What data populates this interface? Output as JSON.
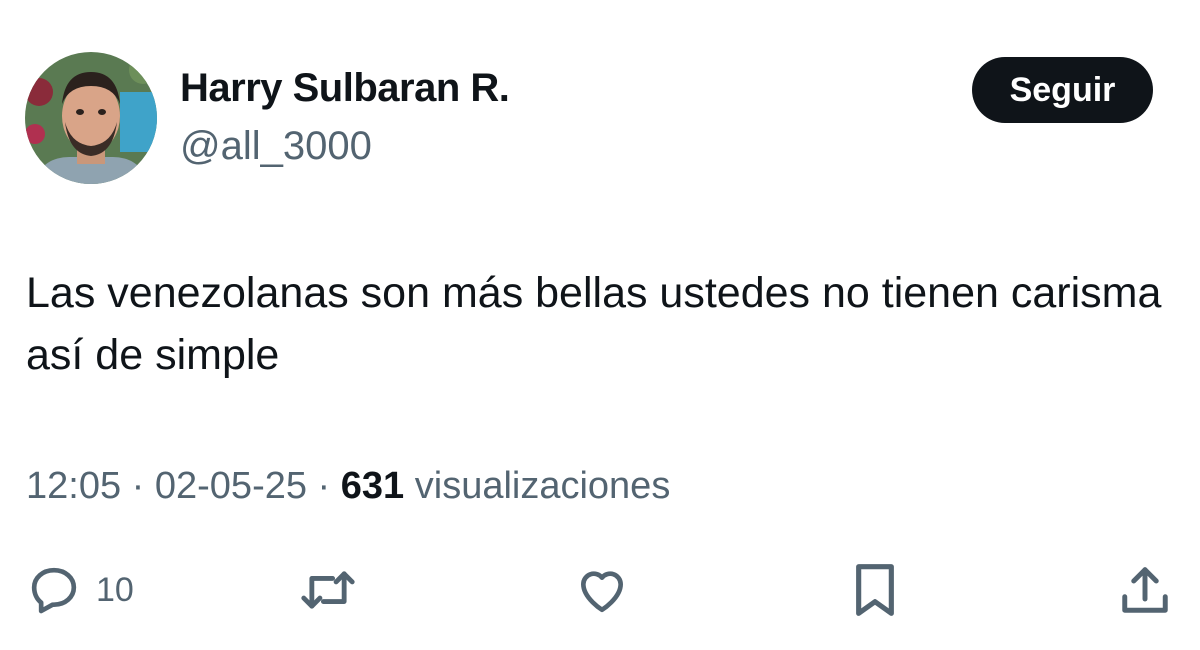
{
  "author": {
    "name": "Harry Sulbaran R.",
    "handle": "@all_3000"
  },
  "follow_button": {
    "label": "Seguir"
  },
  "tweet": {
    "text": "Las venezolanas son más bellas ustedes no tienen carisma así de simple"
  },
  "meta": {
    "time": "12:05",
    "separator": " · ",
    "date": "02-05-25",
    "views_count": "631",
    "views_label": " visualizaciones"
  },
  "actions": {
    "reply": {
      "icon": "reply-icon",
      "count": "10"
    },
    "retweet": {
      "icon": "retweet-icon"
    },
    "like": {
      "icon": "heart-icon"
    },
    "bookmark": {
      "icon": "bookmark-icon"
    },
    "share": {
      "icon": "share-icon"
    }
  },
  "colors": {
    "text_primary": "#0f1419",
    "text_secondary": "#536471",
    "button_bg": "#0f1419",
    "button_text": "#ffffff"
  }
}
